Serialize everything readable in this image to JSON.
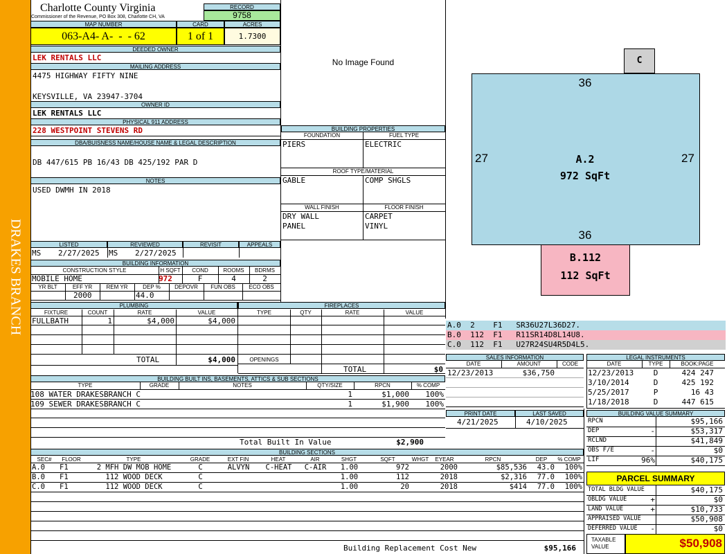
{
  "county": {
    "name": "Charlotte County Virginia",
    "address": "Commissioner of the Revenue, PO Box 308, Charlotte CH, VA"
  },
  "sidebar": {
    "label": "DRAKES BRANCH"
  },
  "record": {
    "label": "RECORD",
    "value": "9758"
  },
  "map": {
    "map_label": "MAP NUMBER",
    "map_value": "063-A4- A-  -  - 62",
    "card_label": "CARD",
    "card_value": "1 of 1",
    "acres_label": "ACRES",
    "acres_value": "1.7300"
  },
  "owner": {
    "deeded_label": "DEEDED OWNER",
    "deeded_value": "LEK RENTALS LLC",
    "mailing_label": "MAILING ADDRESS",
    "mailing_line1": "4475 HIGHWAY FIFTY NINE",
    "mailing_line2": "KEYSVILLE, VA 23947-3704",
    "owner_id_label": "OWNER ID",
    "owner_id_value": "LEK RENTALS LLC",
    "physical_label": "PHYSICAL 911 ADDRESS",
    "physical_value": "228 WESTPOINT STEVENS RD"
  },
  "dba": {
    "label": "DBA/BUISNESS NAME/HOUSE NAME & LEGAL DESCRIPTION",
    "value": "DB 447/615 PB 16/43 DB 425/192 PAR D"
  },
  "notes": {
    "label": "NOTES",
    "value": "USED DWMH IN 2018"
  },
  "image": {
    "text": "No Image Found"
  },
  "status": {
    "listed_label": "LISTED",
    "reviewed_label": "REVIEWED",
    "revisit_label": "REVISIT",
    "appeals_label": "APPEALS",
    "listed_by": "MS",
    "listed_date": "2/27/2025",
    "reviewed_by": "MS",
    "reviewed_date": "2/27/2025"
  },
  "building_info": {
    "label": "BUILDING INFORMATION",
    "style_label": "CONSTRUCTION STYLE",
    "hsqft_label": "H SQFT",
    "cond_label": "COND",
    "rooms_label": "ROOMS",
    "bdrms_label": "BDRMS",
    "style": "MOBILE HOME",
    "hsqft": "972",
    "cond": "F",
    "rooms": "4",
    "bdrms": "2",
    "yrblt_label": "YR BLT",
    "effyr_label": "EFF YR",
    "remyr_label": "REM YR",
    "dep_label": "DEP %",
    "depovr_label": "DEPOVR",
    "funobs_label": "FUN OBS",
    "ecoobs_label": "ECO OBS",
    "effyr": "2000",
    "dep": "44.0"
  },
  "building_props": {
    "label": "BUILDING PROPERTIES",
    "foundation_label": "FOUNDATION",
    "fuel_label": "FUEL TYPE",
    "foundation": "PIERS",
    "fuel": "ELECTRIC",
    "roof_label": "ROOF TYPE/MATERIAL",
    "roof_type": "GABLE",
    "roof_material": "COMP SHGLS",
    "wall_label": "WALL FINISH",
    "floor_label": "FLOOR FINISH",
    "wall1": "DRY WALL",
    "wall2": "PANEL",
    "floor1": "CARPET",
    "floor2": "VINYL"
  },
  "plumbing": {
    "label": "PLUMBING",
    "fixture_label": "FIXTURE",
    "count_label": "COUNT",
    "rate_label": "RATE",
    "value_label": "VALUE",
    "rows": [
      {
        "fixture": "FULLBATH",
        "count": "1",
        "rate": "$4,000",
        "value": "$4,000"
      }
    ],
    "total_label": "TOTAL",
    "total": "$4,000"
  },
  "fireplaces": {
    "label": "FIREPLACES",
    "type_label": "TYPE",
    "qty_label": "QTY",
    "rate_label": "RATE",
    "value_label": "VALUE",
    "openings_label": "OPENINGS",
    "total_label": "TOTAL",
    "total": "$0"
  },
  "sketch": {
    "main_label": "A.2",
    "main_area": "972 SqFt",
    "top": "36",
    "bottom": "36",
    "left": "27",
    "right": "27",
    "addon_label": "C",
    "deck_label": "B.112",
    "deck_area": "112 SqFt"
  },
  "sketch_codes": [
    {
      "text": "A.0  2    F1   SR36U27L36D27.",
      "color": "#b7dde8"
    },
    {
      "text": "B.0  112  F1   R11SR14D8L14U8.",
      "color": "#f7b6c2"
    },
    {
      "text": "C.0  112  F1   U27R24SU4R5D4L5.",
      "color": "#d0d0d0"
    }
  ],
  "sales": {
    "label": "SALES INFORMATION",
    "date_label": "DATE",
    "amount_label": "AMOUNT",
    "code_label": "CODE",
    "rows": [
      {
        "date": "12/23/2013",
        "amount": "$36,750",
        "code": ""
      }
    ]
  },
  "legal": {
    "label": "LEGAL INSTRUMENTS",
    "date_label": "DATE",
    "type_label": "TYPE",
    "book_label": "BOOK:PAGE",
    "rows": [
      {
        "date": "12/23/2013",
        "type": "D",
        "book": "424 247"
      },
      {
        "date": "3/10/2014",
        "type": "D",
        "book": "425 192"
      },
      {
        "date": "5/25/2017",
        "type": "P",
        "book": "16 43"
      },
      {
        "date": "1/18/2018",
        "type": "D",
        "book": "447 615"
      }
    ]
  },
  "dates": {
    "print_label": "PRINT DATE",
    "print_value": "4/21/2025",
    "saved_label": "LAST SAVED",
    "saved_value": "4/10/2025"
  },
  "builtins": {
    "label": "BUILDING BUILT INS, BASEMENTS, ATTICS & SUB SECTIONS",
    "type_label": "TYPE",
    "grade_label": "GRADE",
    "notes_label": "NOTES",
    "qty_label": "QTY/SIZE",
    "rpcn_label": "RPCN",
    "comp_label": "% COMP",
    "rows": [
      {
        "type": "108 WATER DRAKESBRANCH C",
        "qty": "1",
        "rpcn": "$1,000",
        "comp": "100%"
      },
      {
        "type": "109 SEWER DRAKESBRANCH C",
        "qty": "1",
        "rpcn": "$1,900",
        "comp": "100%"
      }
    ],
    "total_label": "Total Built In Value",
    "total": "$2,900"
  },
  "sections": {
    "label": "BUILDING SECTIONS",
    "headers": [
      "SEC#",
      "FLOOR",
      "TYPE",
      "GRADE",
      "EXT FIN",
      "HEAT",
      "AIR",
      "SHGT",
      "SQFT",
      "WHGT",
      "EYEAR",
      "RPCN",
      "DEP",
      "% COMP"
    ],
    "rows": [
      [
        "A.0",
        "F1",
        "2 MFH DW MOB HOME",
        "C",
        "ALVYN",
        "C-HEAT",
        "C-AIR",
        "1.00",
        "972",
        "",
        "2000",
        "$85,536",
        "43.0",
        "100%"
      ],
      [
        "B.0",
        "F1",
        "112 WOOD DECK",
        "C",
        "",
        "",
        "",
        "1.00",
        "112",
        "",
        "2018",
        "$2,316",
        "77.0",
        "100%"
      ],
      [
        "C.0",
        "F1",
        "112 WOOD DECK",
        "C",
        "",
        "",
        "",
        "1.00",
        "20",
        "",
        "2018",
        "$414",
        "77.0",
        "100%"
      ]
    ],
    "replacement_label": "Building Replacement Cost New",
    "replacement": "$95,166"
  },
  "value_summary": {
    "label": "BUILDING VALUE SUMMARY",
    "rows": [
      {
        "label": "RPCN",
        "sign": "",
        "value": "$95,166"
      },
      {
        "label": "DEP",
        "sign": "-",
        "value": "$53,317"
      },
      {
        "label": "RCLND",
        "sign": "",
        "value": "$41,849"
      },
      {
        "label": "OBS F/E",
        "sign": "-",
        "value": "$0"
      },
      {
        "label": "LIF",
        "sign": "96%",
        "value": "$40,175"
      }
    ]
  },
  "parcel": {
    "label": "PARCEL SUMMARY",
    "rows": [
      {
        "label": "TOTAL BLDG VALUE",
        "sign": "",
        "value": "$40,175"
      },
      {
        "label": "OBLDG VALUE",
        "sign": "+",
        "value": "$0"
      },
      {
        "label": "LAND VALUE",
        "sign": "+",
        "value": "$10,733"
      },
      {
        "label": "APPRAISED VALUE",
        "sign": "",
        "value": "$50,908"
      },
      {
        "label": "DEFERRED VALUE",
        "sign": "-",
        "value": "$0"
      }
    ],
    "taxable_label": "TAXABLE VALUE",
    "taxable_value": "$50,908"
  }
}
